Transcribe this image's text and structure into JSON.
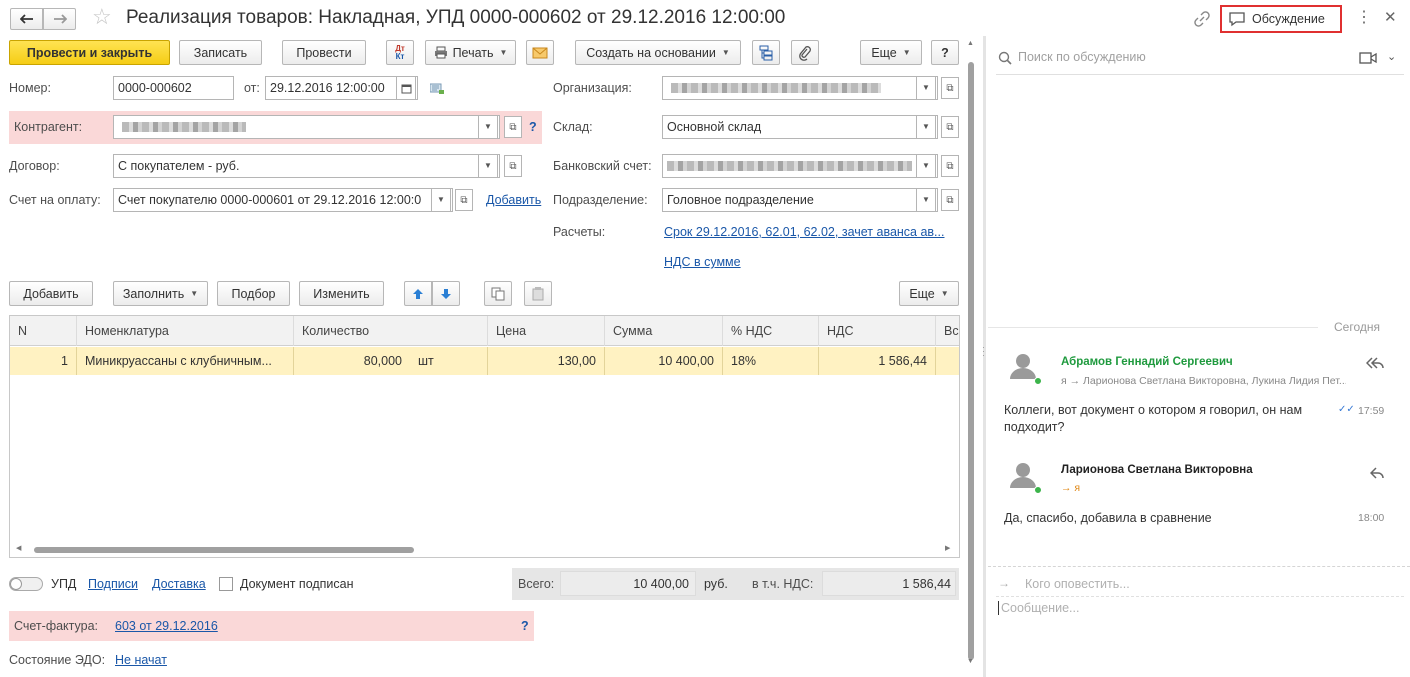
{
  "title": "Реализация товаров: Накладная, УПД 0000-000602 от 29.12.2016 12:00:00",
  "header": {
    "discussion_button": "Обсуждение"
  },
  "toolbar": {
    "post_close": "Провести и закрыть",
    "save": "Записать",
    "post": "Провести",
    "dtkt_top": "Дт",
    "dtkt_bottom": "Кт",
    "print": "Печать",
    "create_based": "Создать на основании",
    "more": "Еще",
    "help": "?"
  },
  "form": {
    "number_label": "Номер:",
    "number_value": "0000-000602",
    "date_label": "от:",
    "date_value": "29.12.2016 12:00:00",
    "counterparty_label": "Контрагент:",
    "contract_label": "Договор:",
    "contract_value": "С покупателем - руб.",
    "invoice_label": "Счет на оплату:",
    "invoice_value": "Счет покупателю 0000-000601 от 29.12.2016 12:00:0",
    "invoice_add": "Добавить",
    "org_label": "Организация:",
    "warehouse_label": "Склад:",
    "warehouse_value": "Основной склад",
    "bank_label": "Банковский счет:",
    "division_label": "Подразделение:",
    "division_value": "Головное подразделение",
    "settlements_label": "Расчеты:",
    "settlements_link": "Срок 29.12.2016, 62.01, 62.02, зачет аванса ав...",
    "vat_link": "НДС в сумме",
    "help_q": "?"
  },
  "table_toolbar": {
    "add": "Добавить",
    "fill": "Заполнить",
    "select": "Подбор",
    "change": "Изменить",
    "more": "Еще"
  },
  "table": {
    "headers": [
      "N",
      "Номенклатура",
      "Количество",
      "Цена",
      "Сумма",
      "% НДС",
      "НДС",
      "Вс"
    ],
    "row": {
      "n": "1",
      "name": "Миникруассаны с клубничным...",
      "qty": "80,000",
      "unit": "шт",
      "price": "130,00",
      "sum": "10 400,00",
      "vat_rate": "18%",
      "vat": "1 586,44"
    }
  },
  "footer": {
    "upd_label": "УПД",
    "signatures": "Подписи",
    "delivery": "Доставка",
    "signed_label": "Документ подписан",
    "total_label": "Всего:",
    "total_value": "10 400,00",
    "currency": "руб.",
    "vat_incl_label": "в т.ч. НДС:",
    "vat_value": "1 586,44",
    "sf_label": "Счет-фактура:",
    "sf_link": "603 от 29.12.2016",
    "sf_help": "?",
    "edo_label": "Состояние ЭДО:",
    "edo_link": "Не начат"
  },
  "discussion": {
    "search_placeholder": "Поиск по обсуждению",
    "today": "Сегодня",
    "messages": [
      {
        "author": "Абрамов Геннадий Сергеевич",
        "recipients": "я → Ларионова Светлана Викторовна, Лукина Лидия Пет...",
        "text": "Коллеги, вот документ о котором я говорил, он нам подходит?",
        "time": "17:59"
      },
      {
        "author": "Ларионова Светлана Викторовна",
        "recipients": "→ я",
        "text": "Да, спасибо, добавила в сравнение",
        "time": "18:00"
      }
    ],
    "notify_placeholder": "Кого оповестить...",
    "message_placeholder": "Сообщение..."
  },
  "colors": {
    "accent_link": "#1a57a8",
    "yellow_button": "#f5cd15",
    "pink_highlight": "#fad8d8",
    "selected_row": "#fff2c2",
    "author_green": "#1f9a3e",
    "red_outline": "#e03030"
  }
}
